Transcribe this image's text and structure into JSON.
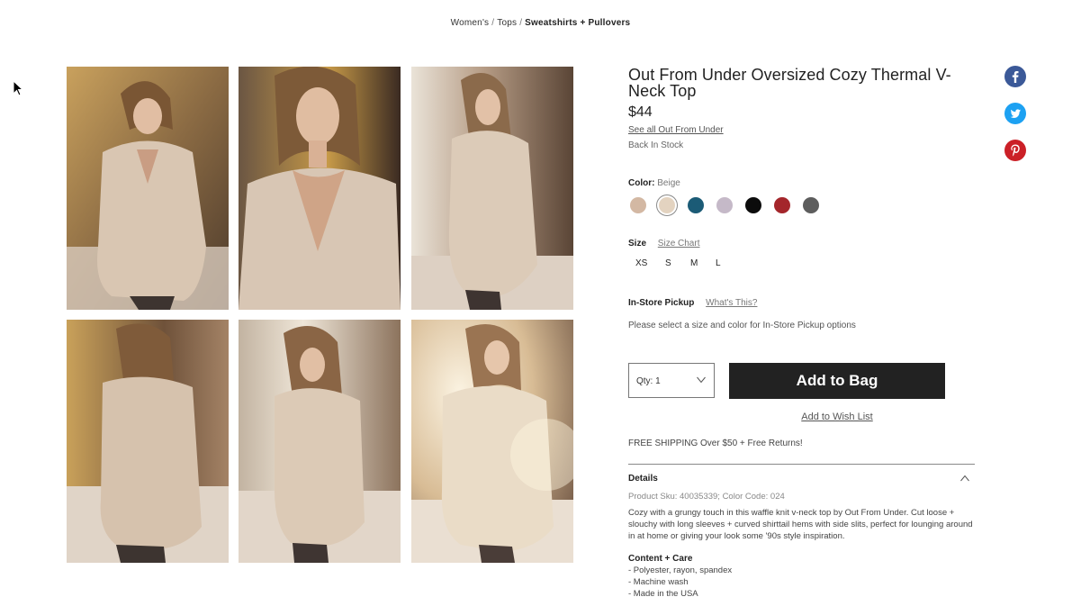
{
  "breadcrumb": {
    "items": [
      "Women's",
      "Tops"
    ],
    "separator": "/",
    "current": "Sweatshirts + Pullovers"
  },
  "gallery": {
    "photos": [
      {
        "name": "product-photo-front",
        "palette": "warm-gold"
      },
      {
        "name": "product-photo-closeup",
        "palette": "warm-amber"
      },
      {
        "name": "product-photo-side",
        "palette": "cool-light"
      },
      {
        "name": "product-photo-back",
        "palette": "warm-gold"
      },
      {
        "name": "product-photo-pose",
        "palette": "cool-light"
      },
      {
        "name": "product-photo-sunlit",
        "palette": "warm-bright"
      }
    ]
  },
  "product": {
    "title": "Out From Under Oversized Cozy Thermal V-Neck Top",
    "price": "$44",
    "brand_link": "See all Out From Under",
    "stock": "Back In Stock"
  },
  "color": {
    "label": "Color:",
    "selected_name": "Beige",
    "swatches": [
      {
        "hex": "#d3b8a3",
        "selected": false
      },
      {
        "hex": "#e3d3c0",
        "selected": true
      },
      {
        "hex": "#1b5b76",
        "selected": false
      },
      {
        "hex": "#c5b9c8",
        "selected": false
      },
      {
        "hex": "#0c0c0c",
        "selected": false
      },
      {
        "hex": "#a4262b",
        "selected": false
      },
      {
        "hex": "#5d5d5d",
        "selected": false
      }
    ]
  },
  "size": {
    "label": "Size",
    "chart_link": "Size Chart",
    "options": [
      "XS",
      "S",
      "M",
      "L"
    ]
  },
  "pickup": {
    "label": "In-Store Pickup",
    "help_link": "What's This?",
    "note": "Please select a size and color for In-Store Pickup options"
  },
  "purchase": {
    "qty_label": "Qty: 1",
    "add_to_bag": "Add to Bag",
    "wish_list": "Add to Wish List"
  },
  "shipping": "FREE SHIPPING Over $50 + Free Returns!",
  "details": {
    "heading": "Details",
    "sku": "Product Sku: 40035339; Color Code: 024",
    "description": "Cozy with a grungy touch in this waffle knit v-neck top by Out From Under. Cut loose + slouchy with long sleeves + curved shirttail hems with side slits, perfect for lounging around in at home or giving your look some '90s style inspiration.",
    "care_heading": "Content + Care",
    "care_items": [
      "- Polyester, rayon, spandex",
      "- Machine wash",
      "- Made in the USA"
    ]
  },
  "social": {
    "facebook_color": "#3b5998",
    "twitter_color": "#1da1f2",
    "pinterest_color": "#cb2027"
  }
}
